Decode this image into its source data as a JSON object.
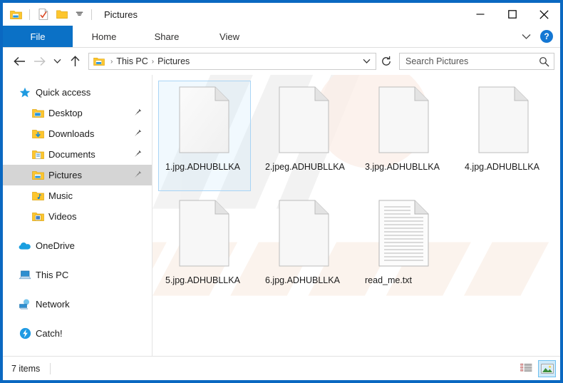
{
  "window": {
    "title": "Pictures",
    "quick_access_toolbar": [
      {
        "name": "pictures-folder-icon",
        "label": "Pictures"
      },
      {
        "name": "properties-icon",
        "label": "Properties"
      },
      {
        "name": "new-folder-icon",
        "label": "New folder"
      },
      {
        "name": "customize-chevron-icon",
        "label": "Customize Quick Access Toolbar"
      }
    ],
    "controls": {
      "minimize": "─",
      "maximize": "☐",
      "close": "✕"
    }
  },
  "ribbon": {
    "tabs": [
      {
        "label": "File",
        "active": true
      },
      {
        "label": "Home",
        "active": false
      },
      {
        "label": "Share",
        "active": false
      },
      {
        "label": "View",
        "active": false
      }
    ],
    "collapse_label": "∨",
    "help_label": "?"
  },
  "nav": {
    "back_label": "Back",
    "forward_label": "Forward",
    "recent_label": "Recent locations",
    "up_label": "Up",
    "refresh_label": "Refresh",
    "address": {
      "icon_name": "pictures-folder-icon",
      "crumbs": [
        "This PC",
        "Pictures"
      ],
      "separator": "›",
      "dropdown_label": "∨"
    }
  },
  "search": {
    "placeholder": "Search Pictures",
    "value": ""
  },
  "sidebar": {
    "groups": [
      {
        "header": {
          "label": "Quick access",
          "icon": "star-icon"
        },
        "items": [
          {
            "label": "Desktop",
            "icon": "folder-desktop-icon",
            "pinned": true,
            "selected": false
          },
          {
            "label": "Downloads",
            "icon": "folder-downloads-icon",
            "pinned": true,
            "selected": false
          },
          {
            "label": "Documents",
            "icon": "folder-documents-icon",
            "pinned": true,
            "selected": false
          },
          {
            "label": "Pictures",
            "icon": "folder-pictures-icon",
            "pinned": true,
            "selected": true
          },
          {
            "label": "Music",
            "icon": "folder-music-icon",
            "pinned": false,
            "selected": false
          },
          {
            "label": "Videos",
            "icon": "folder-videos-icon",
            "pinned": false,
            "selected": false
          }
        ]
      },
      {
        "header": {
          "label": "OneDrive",
          "icon": "onedrive-cloud-icon"
        },
        "items": []
      },
      {
        "header": {
          "label": "This PC",
          "icon": "this-pc-icon"
        },
        "items": []
      },
      {
        "header": {
          "label": "Network",
          "icon": "network-icon"
        },
        "items": []
      },
      {
        "header": {
          "label": "Catch!",
          "icon": "catch-app-icon"
        },
        "items": []
      }
    ]
  },
  "files": [
    {
      "name": "1.jpg.ADHUBLLKA",
      "type": "blank",
      "selected": true
    },
    {
      "name": "2.jpeg.ADHUBLLKA",
      "type": "blank",
      "selected": false
    },
    {
      "name": "3.jpg.ADHUBLLKA",
      "type": "blank",
      "selected": false
    },
    {
      "name": "4.jpg.ADHUBLLKA",
      "type": "blank",
      "selected": false
    },
    {
      "name": "5.jpg.ADHUBLLKA",
      "type": "blank",
      "selected": false
    },
    {
      "name": "6.jpg.ADHUBLLKA",
      "type": "blank",
      "selected": false
    },
    {
      "name": "read_me.txt",
      "type": "text",
      "selected": false
    }
  ],
  "status": {
    "item_count": "7 items",
    "views": [
      {
        "name": "details-view-button",
        "label": "Details view",
        "active": false
      },
      {
        "name": "large-icons-view-button",
        "label": "Large icons view",
        "active": true
      }
    ]
  },
  "colors": {
    "window_border": "#0a68c1",
    "file_tab": "#0b71c6",
    "selection": "#a9d4f5",
    "sidebar_selected": "#d5d5d5",
    "help_blue": "#1477d3"
  }
}
